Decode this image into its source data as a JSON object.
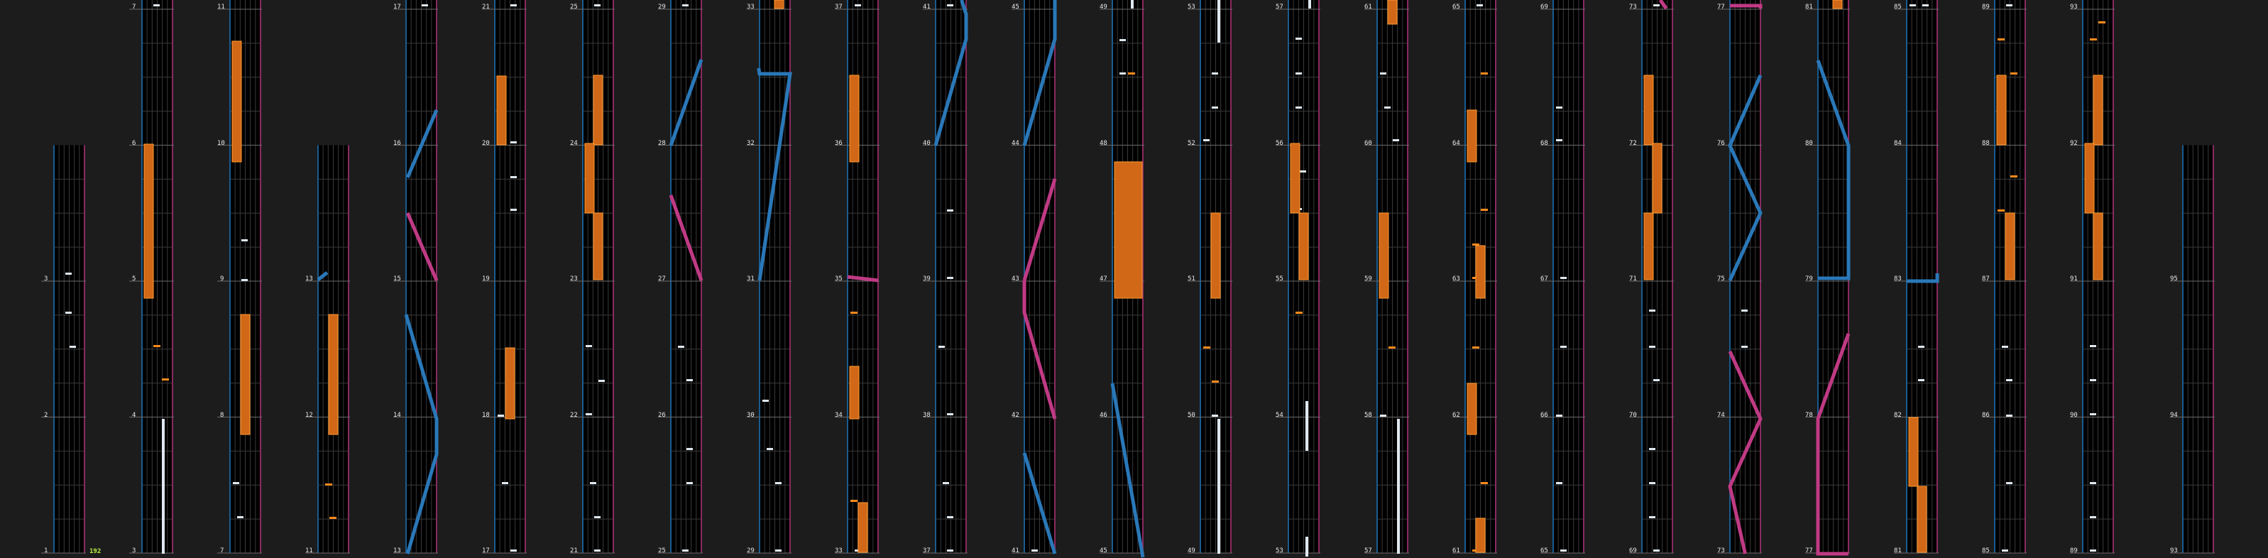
{
  "combo": "192",
  "colors": {
    "background": "#1c1c1c",
    "lane_background": "#000000",
    "lane_grid": "#3a3a3a",
    "beat_line": "#6a6a6a",
    "left_border": "#1a5c90",
    "right_border": "#8a2a60",
    "note": "#dfe8f0",
    "orange_note": "#ff8a1c",
    "hold": "#d06818",
    "hold_edge": "#ff9a30",
    "blue_slide": "#2a78b8",
    "pink_slide": "#c03a84"
  },
  "icons": [
    "tap-note",
    "orange-note",
    "hold-bar",
    "slide-line"
  ],
  "columns": [
    {
      "measures": [
        3,
        2,
        1
      ]
    },
    {
      "measures": [
        7,
        6,
        5,
        4,
        3
      ]
    },
    {
      "measures": [
        11,
        10,
        9,
        8,
        7
      ]
    },
    {
      "measures": [
        13,
        12,
        11
      ]
    },
    {
      "measures": [
        17,
        16,
        15,
        14,
        13
      ]
    },
    {
      "measures": [
        21,
        20,
        19,
        18,
        17
      ]
    },
    {
      "measures": [
        25,
        24,
        23,
        22,
        21
      ]
    },
    {
      "measures": [
        29,
        28,
        27,
        26,
        25
      ]
    },
    {
      "measures": [
        33,
        32,
        31,
        30,
        29
      ]
    },
    {
      "measures": [
        37,
        36,
        35,
        34,
        33
      ]
    },
    {
      "measures": [
        41,
        40,
        39,
        38,
        37
      ]
    },
    {
      "measures": [
        45,
        44,
        43,
        42,
        41
      ]
    },
    {
      "measures": [
        49,
        48,
        47,
        46,
        45
      ]
    },
    {
      "measures": [
        53,
        52,
        51,
        50,
        49
      ]
    },
    {
      "measures": [
        57,
        56,
        55,
        54,
        53
      ]
    },
    {
      "measures": [
        61,
        60,
        59,
        58,
        57
      ]
    },
    {
      "measures": [
        65,
        64,
        63,
        62,
        61
      ]
    },
    {
      "measures": [
        69,
        68,
        67,
        66,
        65
      ]
    },
    {
      "measures": [
        73,
        72,
        71,
        70,
        69
      ]
    },
    {
      "measures": [
        77,
        76,
        75,
        74,
        73
      ]
    },
    {
      "measures": [
        81,
        80,
        79,
        78,
        77
      ]
    },
    {
      "measures": [
        85,
        84,
        83,
        82,
        81
      ]
    },
    {
      "measures": [
        89,
        88,
        87,
        86,
        85
      ]
    },
    {
      "measures": [
        93,
        92,
        91,
        90,
        89
      ]
    },
    {
      "measures": [
        95,
        94,
        93
      ]
    }
  ]
}
